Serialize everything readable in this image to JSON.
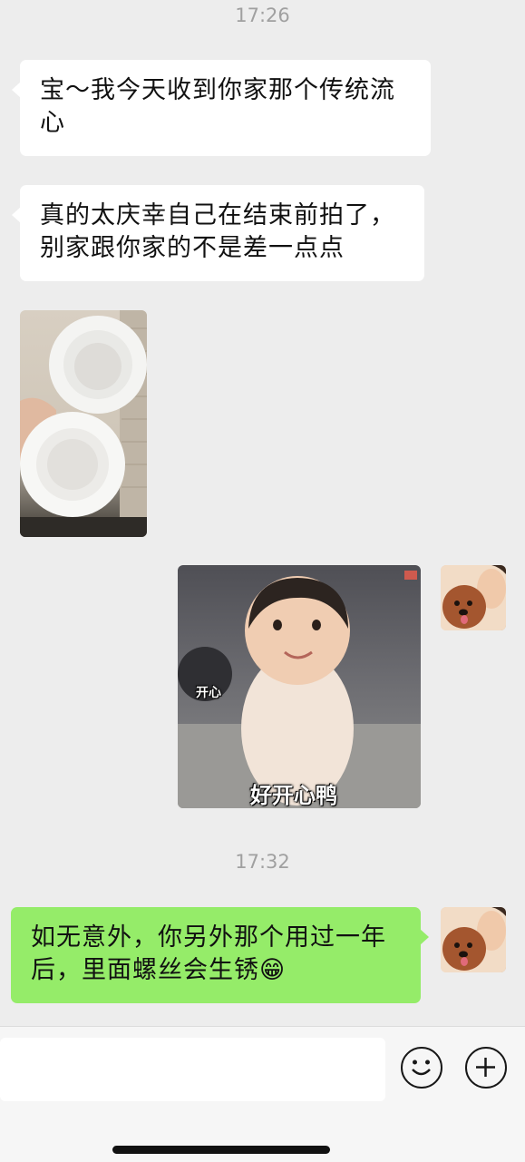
{
  "chat": {
    "timestamps": [
      "17:26",
      "17:32"
    ],
    "messages": [
      {
        "side": "in",
        "type": "text",
        "text": "宝～我今天收到你家那个传统流心"
      },
      {
        "side": "in",
        "type": "text",
        "text": "真的太庆幸自己在结束前拍了，别家跟你家的不是差一点点"
      },
      {
        "side": "in",
        "type": "image",
        "content": "white silicone mooncake molds photo"
      },
      {
        "side": "out",
        "type": "sticker",
        "caption_small": "开心",
        "caption_big": "好开心鸭"
      },
      {
        "side": "out",
        "type": "text",
        "text": "如无意外，你另外那个用过一年后，里面螺丝会生锈",
        "emoji": "😁"
      }
    ]
  },
  "input_bar": {
    "placeholder": "",
    "emoji_button_icon": "smiley-icon",
    "more_button_icon": "plus-icon"
  },
  "colors": {
    "background": "#ededed",
    "incoming_bubble": "#ffffff",
    "outgoing_bubble": "#95ec69",
    "timestamp": "#a0a0a0"
  }
}
